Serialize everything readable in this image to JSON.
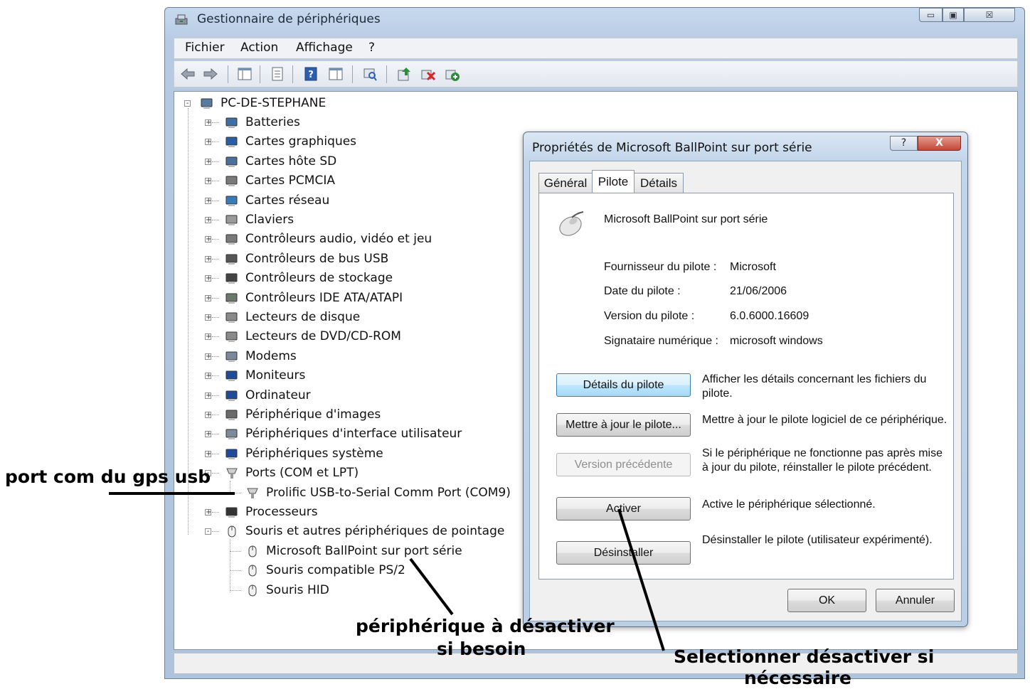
{
  "window": {
    "title": "Gestionnaire de périphériques",
    "controls": {
      "minimize": "▭",
      "maximize": "▣",
      "close": "☒"
    }
  },
  "menu": [
    "Fichier",
    "Action",
    "Affichage",
    "?"
  ],
  "tree": {
    "root": "PC-DE-STEPHANE",
    "categories": [
      "Batteries",
      "Cartes graphiques",
      "Cartes hôte SD",
      "Cartes PCMCIA",
      "Cartes réseau",
      "Claviers",
      "Contrôleurs audio, vidéo et jeu",
      "Contrôleurs de bus USB",
      "Contrôleurs de stockage",
      "Contrôleurs IDE ATA/ATAPI",
      "Lecteurs de disque",
      "Lecteurs de DVD/CD-ROM",
      "Modems",
      "Moniteurs",
      "Ordinateur",
      "Périphérique d'images",
      "Périphériques d'interface utilisateur",
      "Périphériques système",
      "Ports (COM et LPT)",
      "Prolific USB-to-Serial Comm Port (COM9)",
      "Processeurs",
      "Souris et autres périphériques de pointage",
      "Microsoft BallPoint sur port série",
      "Souris compatible PS/2",
      "Souris HID"
    ]
  },
  "dialog": {
    "title": "Propriétés de Microsoft BallPoint sur port série",
    "help": "?",
    "close": "X",
    "tabs": [
      "Général",
      "Pilote",
      "Détails"
    ],
    "active_tab": "Pilote",
    "device_name": "Microsoft BallPoint sur port série",
    "fields": [
      {
        "label": "Fournisseur du pilote :",
        "value": "Microsoft"
      },
      {
        "label": "Date du pilote :",
        "value": "21/06/2006"
      },
      {
        "label": "Version du pilote :",
        "value": "6.0.6000.16609"
      },
      {
        "label": "Signataire numérique :",
        "value": "microsoft windows"
      }
    ],
    "actions": [
      {
        "button": "Détails du pilote",
        "description": "Afficher les détails concernant les fichiers du pilote."
      },
      {
        "button": "Mettre à jour le pilote...",
        "description": "Mettre à jour le pilote logiciel de ce périphérique."
      },
      {
        "button": "Version précédente",
        "description": "Si le périphérique ne fonctionne pas après mise à jour du pilote, réinstaller le pilote précédent."
      },
      {
        "button": "Activer",
        "description": "Active le périphérique sélectionné."
      },
      {
        "button": "Désinstaller",
        "description": "Désinstaller le pilote (utilisateur expérimenté)."
      }
    ],
    "ok": "OK",
    "cancel": "Annuler"
  },
  "annotations": {
    "port_com": "port com du gps usb",
    "peripherique_1": "périphérique à désactiver",
    "peripherique_2": "si besoin",
    "selectionner_1": "Selectionner désactiver si",
    "selectionner_2": "nécessaire"
  }
}
